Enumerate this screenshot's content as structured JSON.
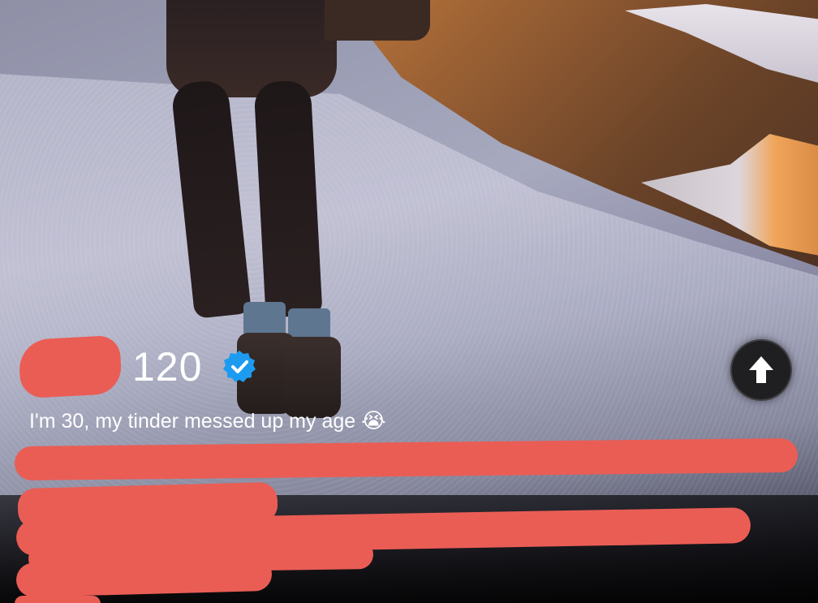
{
  "profile": {
    "age": "120",
    "verified_icon": "verified-badge-icon",
    "verified_color": "#1d9bf0",
    "bio": "I'm 30, my tinder messed up my age",
    "bio_emoji": "😭",
    "bio_hidden": "redacted"
  },
  "actions": {
    "expand_icon": "arrow-up-icon"
  },
  "colors": {
    "redaction": "#ea5d55",
    "button_bg": "#1f1f22",
    "text": "#ffffff"
  }
}
